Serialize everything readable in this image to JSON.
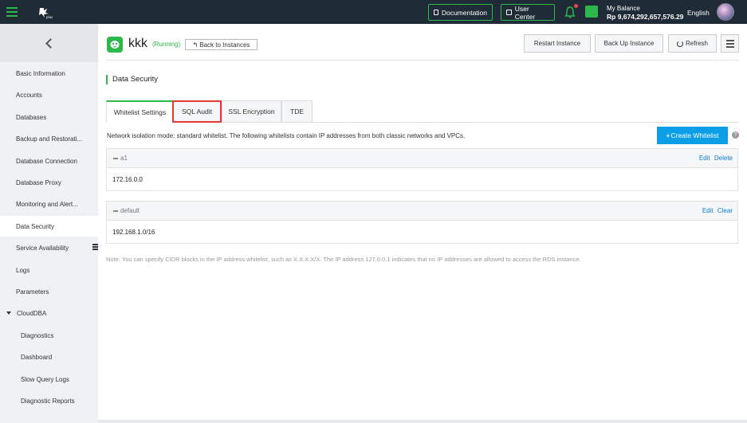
{
  "topbar": {
    "documentation": "Documentation",
    "user_center": "User Center",
    "balance_label": "My Balance",
    "balance_value": "Rp 9,674,292,657,576.29",
    "language": "English"
  },
  "sidebar": {
    "items": [
      {
        "label": "Basic Information"
      },
      {
        "label": "Accounts"
      },
      {
        "label": "Databases"
      },
      {
        "label": "Backup and Restorati..."
      },
      {
        "label": "Database Connection"
      },
      {
        "label": "Database Proxy"
      },
      {
        "label": "Monitoring and Alert..."
      },
      {
        "label": "Data Security"
      },
      {
        "label": "Service Availability"
      },
      {
        "label": "Logs"
      },
      {
        "label": "Parameters"
      },
      {
        "label": "CloudDBA"
      },
      {
        "label": "Diagnostics"
      },
      {
        "label": "Dashboard"
      },
      {
        "label": "Slow Query Logs"
      },
      {
        "label": "Diagnostic Reports"
      }
    ]
  },
  "header": {
    "instance_name": "kkk",
    "status": "(Running)",
    "back_label": "Back to Instances",
    "restart_label": "Restart Instance",
    "backup_label": "Back Up Instance",
    "refresh_label": "Refresh"
  },
  "section": {
    "title": "Data Security"
  },
  "tabs": [
    {
      "label": "Whitelist Settings"
    },
    {
      "label": "SQL Audit"
    },
    {
      "label": "SSL Encryption"
    },
    {
      "label": "TDE"
    }
  ],
  "whitelist": {
    "notice": "Network isolation mode: standard whitelist. The following whitelists contain IP addresses from both classic networks and VPCs.",
    "create_label": "Create Whitelist",
    "groups": [
      {
        "name": "a1",
        "ip": "172.16.0.0",
        "action1": "Edit",
        "action2": "Delete"
      },
      {
        "name": "default",
        "ip": "192.168.1.0/16",
        "action1": "Edit",
        "action2": "Clear"
      }
    ],
    "note": "Note: You can specify CIDR blocks in the IP address whitelist, such as X.X.X.X/X. The IP address 127.0.0.1 indicates that no IP addresses are allowed to access the RDS instance."
  }
}
